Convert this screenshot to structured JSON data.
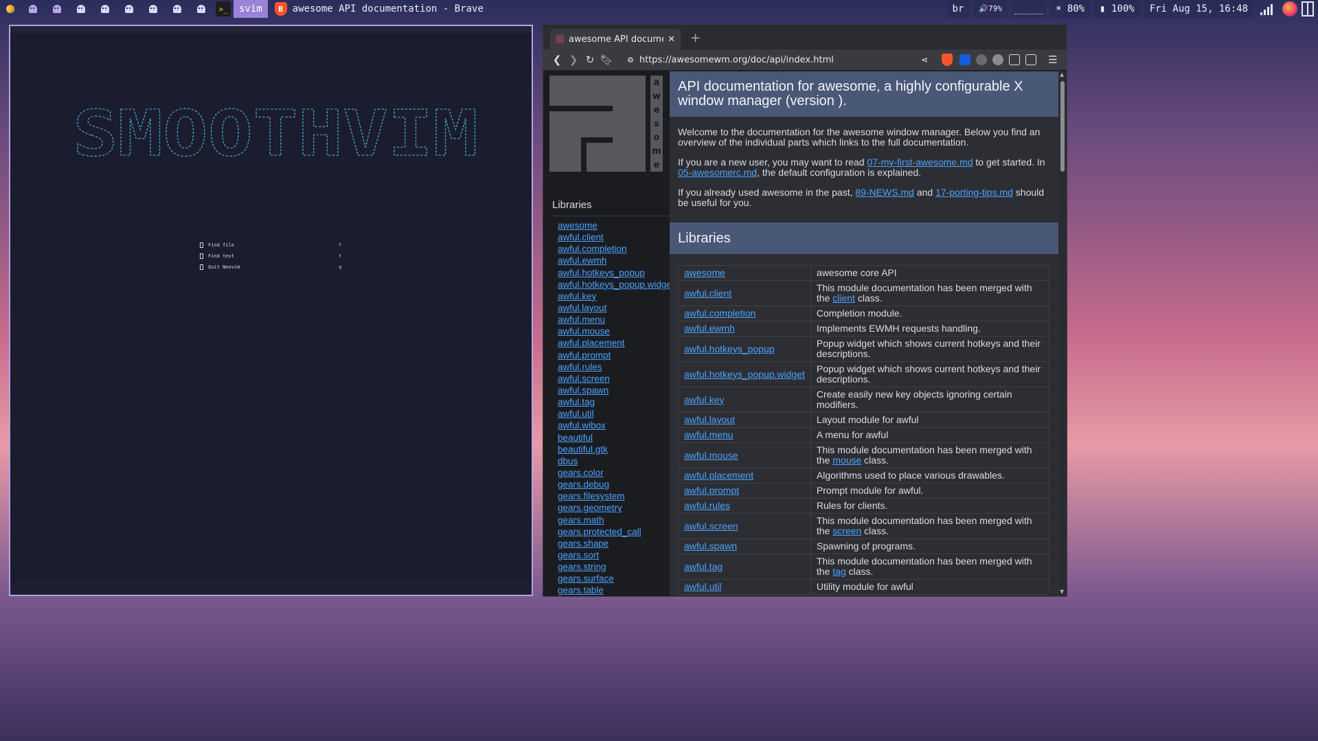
{
  "topbar": {
    "workspace_icons": [
      "moon-icon",
      "ghost-icon",
      "ghost-icon",
      "ghost-icon",
      "ghost-icon",
      "ghost-icon",
      "ghost-icon",
      "ghost-icon",
      "ghost-icon"
    ],
    "active_app": "svim",
    "window_title": "awesome API documentation - Brave",
    "keyboard_layout": "br",
    "volume": "79%",
    "brightness": "80%",
    "battery": "100%",
    "datetime": "Fri Aug 15, 16:48"
  },
  "terminal": {
    "ascii_logo_text": "SMOOTHVIM",
    "logo_color": "#3fa7c9",
    "dashboard": [
      {
        "label": "Find file",
        "key": "f"
      },
      {
        "label": "Find text",
        "key": "t"
      },
      {
        "label": "Quit Neovim",
        "key": "q"
      }
    ]
  },
  "browser": {
    "tab_title": "awesome API document",
    "url": "https://awesomewm.org/doc/api/index.html",
    "logo_strip_letters": [
      "a",
      "w",
      "e",
      "s",
      "o",
      "m",
      "e"
    ],
    "sidebar_heading": "Libraries",
    "sidebar_items": [
      "awesome",
      "awful.client",
      "awful.completion",
      "awful.ewmh",
      "awful.hotkeys_popup",
      "awful.hotkeys_popup.widget",
      "awful.key",
      "awful.layout",
      "awful.menu",
      "awful.mouse",
      "awful.placement",
      "awful.prompt",
      "awful.rules",
      "awful.screen",
      "awful.spawn",
      "awful.tag",
      "awful.util",
      "awful.wibox",
      "beautiful",
      "beautiful.gtk",
      "dbus",
      "gears.color",
      "gears.debug",
      "gears.filesystem",
      "gears.geometry",
      "gears.math",
      "gears.protected_call",
      "gears.shape",
      "gears.sort",
      "gears.string",
      "gears.surface",
      "gears.table"
    ],
    "page_title": "API documentation for awesome, a highly configurable X window manager (version ).",
    "intro": {
      "p1": "Welcome to the documentation for the awesome window manager. Below you find an overview of the individual parts which links to the full documentation.",
      "p2_before": "If you are a new user, you may want to read ",
      "p2_link1": "07-my-first-awesome.md",
      "p2_middle": " to get started. In ",
      "p2_link2": "05-awesomerc.md",
      "p2_after": ", the default configuration is explained.",
      "p3_before": "If you already used awesome in the past, ",
      "p3_link1": "89-NEWS.md",
      "p3_middle": " and ",
      "p3_link2": "17-porting-tips.md",
      "p3_after": " should be useful for you."
    },
    "libraries_heading": "Libraries",
    "libraries": [
      {
        "name": "awesome",
        "desc": "awesome core API"
      },
      {
        "name": "awful.client",
        "desc": "This module documentation has been merged with the ",
        "link": "client",
        "desc_after": " class."
      },
      {
        "name": "awful.completion",
        "desc": "Completion module."
      },
      {
        "name": "awful.ewmh",
        "desc": "Implements EWMH requests handling."
      },
      {
        "name": "awful.hotkeys_popup",
        "desc": "Popup widget which shows current hotkeys and their descriptions."
      },
      {
        "name": "awful.hotkeys_popup.widget",
        "desc": "Popup widget which shows current hotkeys and their descriptions."
      },
      {
        "name": "awful.key",
        "desc": "Create easily new key objects ignoring certain modifiers."
      },
      {
        "name": "awful.layout",
        "desc": "Layout module for awful"
      },
      {
        "name": "awful.menu",
        "desc": "A menu for awful"
      },
      {
        "name": "awful.mouse",
        "desc": "This module documentation has been merged with the ",
        "link": "mouse",
        "desc_after": " class."
      },
      {
        "name": "awful.placement",
        "desc": "Algorithms used to place various drawables."
      },
      {
        "name": "awful.prompt",
        "desc": "Prompt module for awful."
      },
      {
        "name": "awful.rules",
        "desc": "Rules for clients."
      },
      {
        "name": "awful.screen",
        "desc": "This module documentation has been merged with the ",
        "link": "screen",
        "desc_after": " class."
      },
      {
        "name": "awful.spawn",
        "desc": "Spawning of programs."
      },
      {
        "name": "awful.tag",
        "desc": "This module documentation has been merged with the ",
        "link": "tag",
        "desc_after": " class."
      },
      {
        "name": "awful.util",
        "desc": "Utility module for awful"
      }
    ]
  }
}
